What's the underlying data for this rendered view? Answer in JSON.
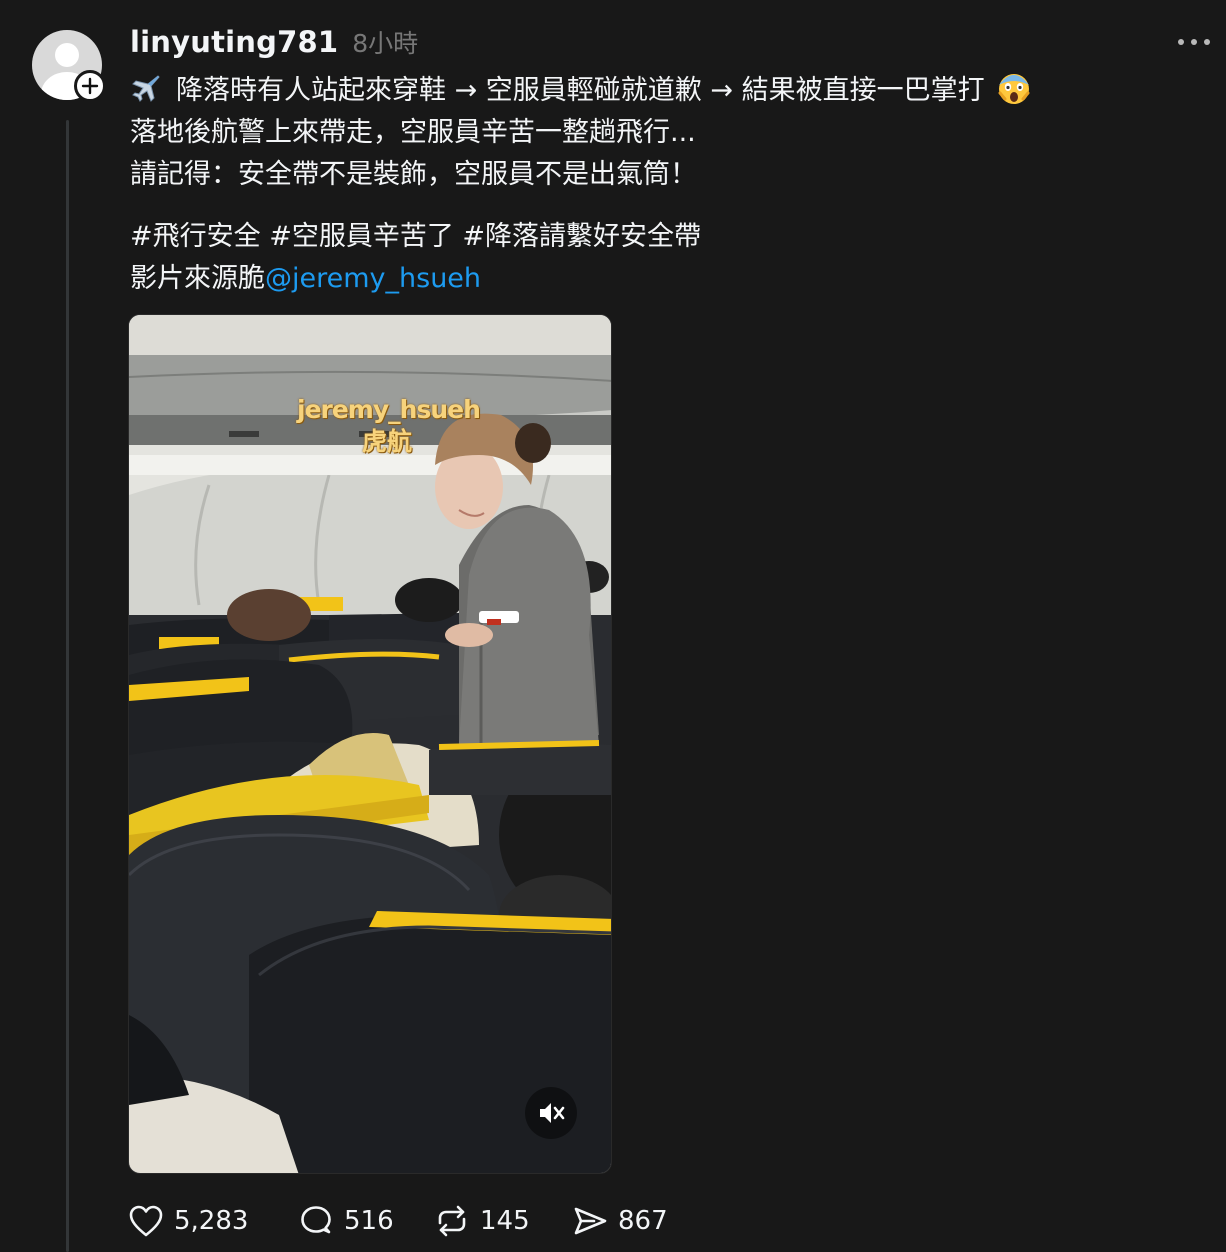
{
  "post": {
    "username": "linyuting781",
    "timestamp": "8小時",
    "lines": [
      "降落時有人站起來穿鞋 → 空服員輕碰就道歉 → 結果被直接一巴掌打",
      "落地後航警上來帶走，空服員辛苦一整趟飛行...",
      "請記得：安全帶不是裝飾，空服員不是出氣筒！"
    ],
    "hashtags": "#飛行安全 #空服員辛苦了 #降落請繫好安全帶",
    "source_prefix": "影片來源脆",
    "mention": "@jeremy_hsueh"
  },
  "video": {
    "watermark_user": "jeremy_hsueh",
    "watermark_airline": "虎航"
  },
  "actions": {
    "likes": "5,283",
    "replies": "516",
    "reposts": "145",
    "shares": "867"
  },
  "icons": {
    "avatar": "default-avatar-icon",
    "follow": "plus-icon",
    "more": "more-dots-icon",
    "plane": "airplane-emoji",
    "scream": "screaming-face-emoji",
    "mute": "muted-speaker-icon",
    "like": "heart-icon",
    "reply": "comment-icon",
    "repost": "repost-icon",
    "share": "send-icon"
  },
  "colors": {
    "background": "#181818",
    "text": "#f3f5f7",
    "muted": "#777777",
    "link": "#1d9bf0",
    "seat_accent": "#f2c318"
  }
}
